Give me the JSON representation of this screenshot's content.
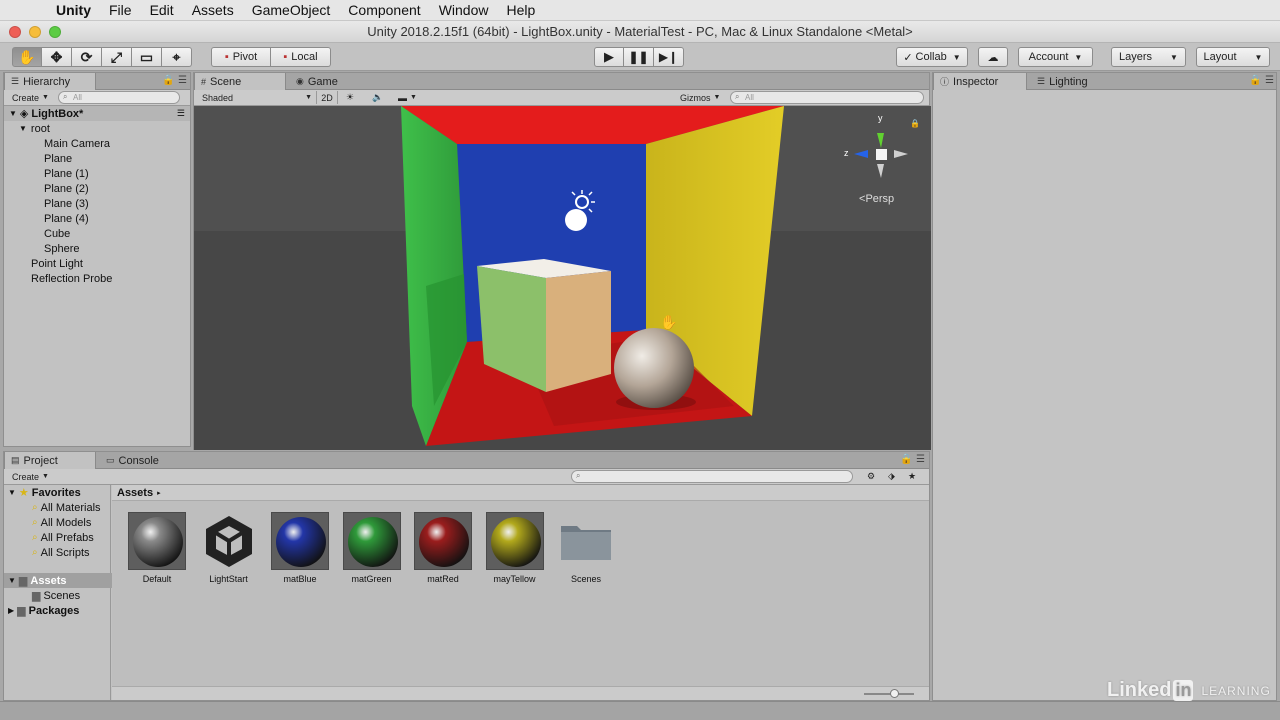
{
  "menubar": {
    "apple": "",
    "app": "Unity",
    "items": [
      "File",
      "Edit",
      "Assets",
      "GameObject",
      "Component",
      "Window",
      "Help"
    ]
  },
  "window": {
    "title": "Unity 2018.2.15f1 (64bit) - LightBox.unity - MaterialTest - PC, Mac & Linux Standalone <Metal>",
    "traffic_colors": [
      "#ee5f57",
      "#f6bd3b",
      "#5ccc44"
    ]
  },
  "toolbar": {
    "tools": [
      {
        "name": "hand-tool",
        "icon": "✋"
      },
      {
        "name": "move-tool",
        "icon": "✥"
      },
      {
        "name": "rotate-tool",
        "icon": "⟳"
      },
      {
        "name": "scale-tool",
        "icon": "⤢"
      },
      {
        "name": "rect-tool",
        "icon": "▭"
      },
      {
        "name": "transform-tool",
        "icon": "⌖"
      }
    ],
    "pivot": "Pivot",
    "local": "Local",
    "collab": "Collab",
    "account": "Account",
    "layers": "Layers",
    "layout": "Layout"
  },
  "hierarchy": {
    "tab": "Hierarchy",
    "create": "Create",
    "search_placeholder": "All",
    "scene": "LightBox*",
    "items": [
      {
        "label": "root",
        "depth": 1,
        "expand": "▼"
      },
      {
        "label": "Main Camera",
        "depth": 2
      },
      {
        "label": "Plane",
        "depth": 2
      },
      {
        "label": "Plane (1)",
        "depth": 2
      },
      {
        "label": "Plane (2)",
        "depth": 2
      },
      {
        "label": "Plane (3)",
        "depth": 2
      },
      {
        "label": "Plane (4)",
        "depth": 2
      },
      {
        "label": "Cube",
        "depth": 2
      },
      {
        "label": "Sphere",
        "depth": 2
      },
      {
        "label": "Point Light",
        "depth": 1
      },
      {
        "label": "Reflection Probe",
        "depth": 1
      }
    ]
  },
  "scene": {
    "tabs": [
      "Scene",
      "Game"
    ],
    "shading": "Shaded",
    "mode2d": "2D",
    "gizmos": "Gizmos",
    "search_placeholder": "All",
    "axis_y": "y",
    "axis_z": "z",
    "persp": "Persp"
  },
  "inspector": {
    "tabs": [
      "Inspector",
      "Lighting"
    ]
  },
  "project": {
    "tabs": [
      "Project",
      "Console"
    ],
    "create": "Create",
    "favorites_label": "Favorites",
    "favorites": [
      "All Materials",
      "All Models",
      "All Prefabs",
      "All Scripts"
    ],
    "assets_root": "Assets",
    "assets_children": [
      "Scenes"
    ],
    "packages": "Packages",
    "breadcrumb": "Assets",
    "assets": [
      {
        "label": "Default",
        "kind": "sphere",
        "color": "#8a8a8a"
      },
      {
        "label": "LightStart",
        "kind": "unity"
      },
      {
        "label": "matBlue",
        "kind": "sphere",
        "color": "#2336a8"
      },
      {
        "label": "matGreen",
        "kind": "sphere",
        "color": "#2f9a3a"
      },
      {
        "label": "matRed",
        "kind": "sphere",
        "color": "#9a1d1d"
      },
      {
        "label": "mayTellow",
        "kind": "sphere",
        "color": "#b2a91c"
      },
      {
        "label": "Scenes",
        "kind": "folder"
      }
    ]
  },
  "watermark": {
    "linked": "Linked",
    "in": "in",
    "learning": "LEARNING"
  }
}
